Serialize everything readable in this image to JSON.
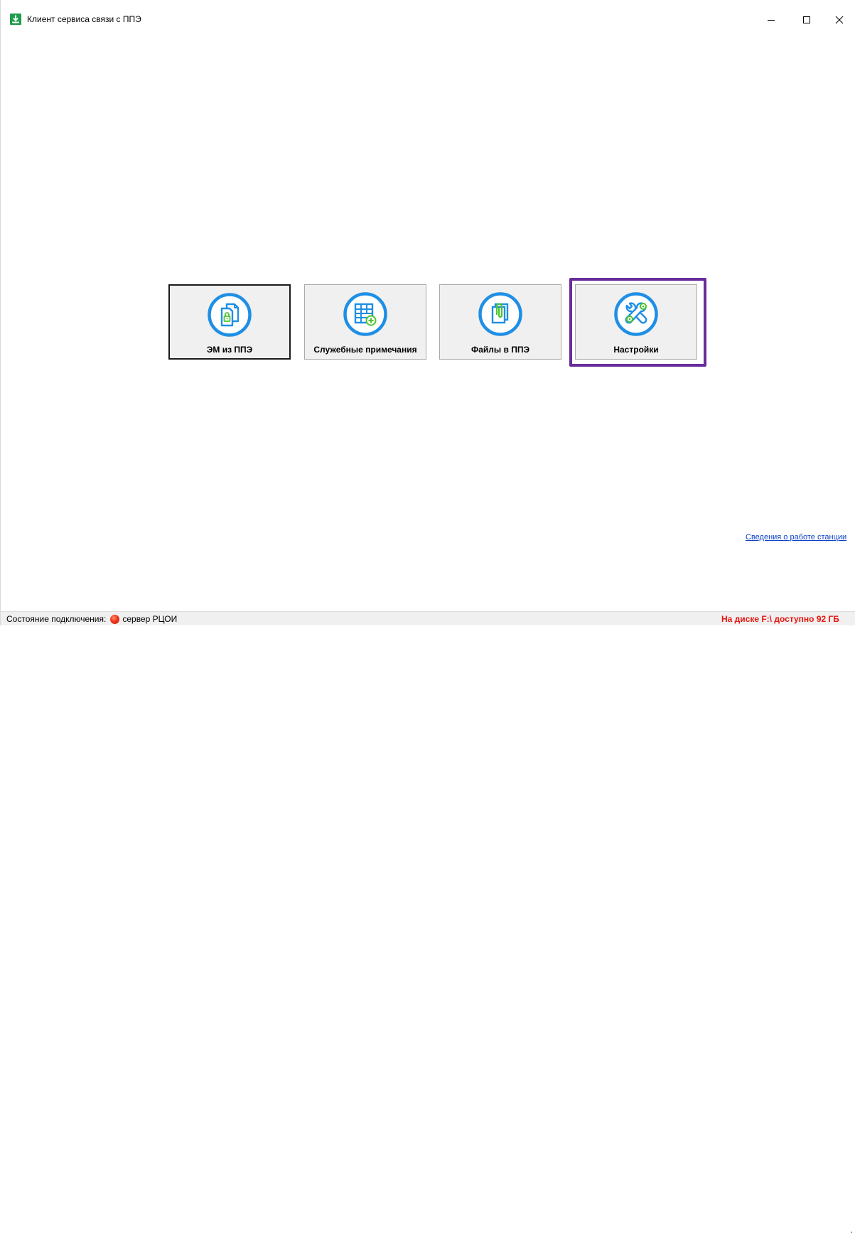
{
  "window": {
    "title": "Клиент сервиса связи с ППЭ",
    "controls": {
      "minimize": "minimize",
      "maximize": "maximize",
      "close": "close"
    }
  },
  "tiles": [
    {
      "label": "ЭМ из ППЭ",
      "icon": "documents-lock-icon"
    },
    {
      "label": "Служебные примечания",
      "icon": "table-add-icon"
    },
    {
      "label": "Файлы в ППЭ",
      "icon": "files-paperclip-icon"
    },
    {
      "label": "Настройки",
      "icon": "wrench-gears-icon",
      "highlighted": true
    }
  ],
  "footer_link": "Сведения о работе станции",
  "status": {
    "connection_label": "Состояние подключения:",
    "server": "сервер РЦОИ",
    "connection_state_color": "#f0341c",
    "disk_info": "На диске F:\\ доступно 92 ГБ"
  },
  "colors": {
    "icon_blue": "#1f8fe5",
    "icon_green": "#4cc52e",
    "highlight_purple": "#6a2c9a",
    "disk_warning": "#e8140c",
    "link": "#0a3fc8"
  }
}
